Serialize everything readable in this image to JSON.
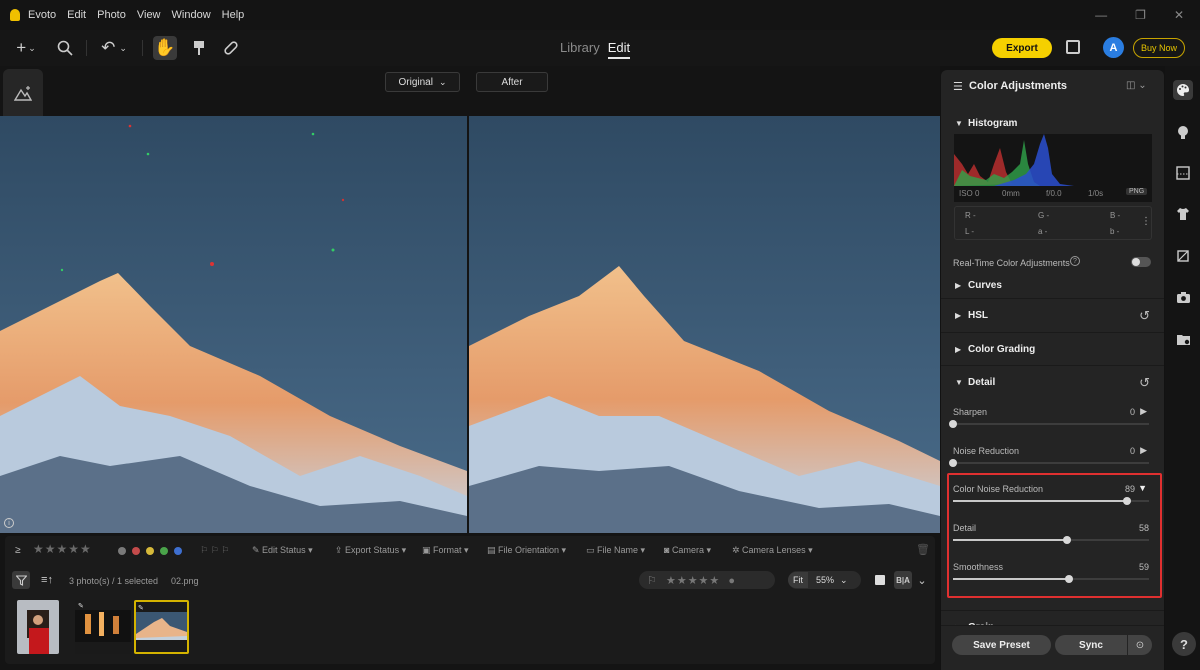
{
  "titlebar": {
    "app_name": "Evoto",
    "menu": [
      "Edit",
      "Photo",
      "View",
      "Window",
      "Help"
    ]
  },
  "toolbar": {
    "mode_library": "Library",
    "mode_edit": "Edit",
    "export_label": "Export",
    "avatar_letter": "A",
    "buy_label": "Buy Now"
  },
  "view": {
    "original_label": "Original",
    "after_label": "After"
  },
  "filterbar": {
    "edit_status": "Edit Status",
    "export_status": "Export Status",
    "format": "Format",
    "file_orientation": "File Orientation",
    "file_name": "File Name",
    "camera": "Camera",
    "camera_lenses": "Camera Lenses",
    "color_labels": [
      "#7a7a7a",
      "#c44b4b",
      "#d6b93a",
      "#4aa44a",
      "#3e6fd0"
    ]
  },
  "filmstrip": {
    "photo_count": "3 photo(s) / 1 selected",
    "filename": "02.png",
    "fit_label": "Fit",
    "zoom_value": "55%"
  },
  "panel": {
    "title": "Color Adjustments",
    "histogram": {
      "label": "Histogram",
      "iso": "ISO 0",
      "focal": "0mm",
      "aperture": "f/0.0",
      "shutter": "1/0s",
      "format_badge": "PNG",
      "r": "R -",
      "g": "G -",
      "b": "B -",
      "l": "L -",
      "a": "a -",
      "bb": "b -"
    },
    "realtime_label": "Real-Time Color Adjustments",
    "sections": {
      "curves": "Curves",
      "hsl": "HSL",
      "color_grading": "Color Grading",
      "detail": "Detail",
      "grain": "Grain"
    },
    "sliders": [
      {
        "label": "Sharpen",
        "value": 0
      },
      {
        "label": "Noise Reduction",
        "value": 0
      },
      {
        "label": "Color Noise Reduction",
        "value": 89
      },
      {
        "label": "Detail",
        "value": 58
      },
      {
        "label": "Smoothness",
        "value": 59
      }
    ],
    "save_preset": "Save Preset",
    "sync": "Sync"
  },
  "accent_colors": {
    "export": "#f5d000",
    "highlight_box": "#e03030",
    "avatar": "#2a7de1"
  }
}
